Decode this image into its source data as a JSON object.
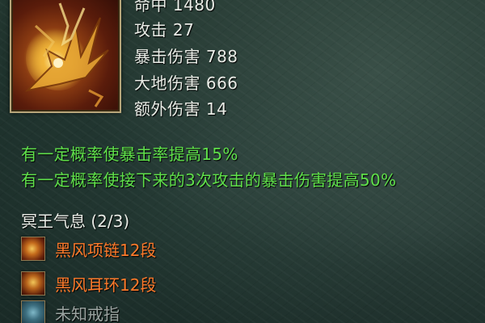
{
  "item": {
    "partial_top_line": "命中 1480",
    "stats": [
      {
        "label": "攻击",
        "value": "27",
        "text": "攻击 27"
      },
      {
        "label": "暴击伤害",
        "value": "788",
        "text": "暴击伤害 788"
      },
      {
        "label": "大地伤害",
        "value": "666",
        "text": "大地伤害 666"
      },
      {
        "label": "额外伤害",
        "value": "14",
        "text": "额外伤害 14"
      }
    ],
    "effects": [
      "有一定概率使暴击率提高15%",
      "有一定概率使接下来的3次攻击的暴击伤害提高50%"
    ],
    "icon": "golden-claw-weapon-icon"
  },
  "set": {
    "title": "冥王气息 (2/3)",
    "pieces": [
      {
        "name": "黑风项链12段",
        "status": "owned",
        "icon": "necklace-icon",
        "color": "#ff7a2a"
      },
      {
        "name": "黑风耳环12段",
        "status": "owned",
        "icon": "earring-icon",
        "color": "#ff7a2a"
      },
      {
        "name": "未知戒指",
        "status": "unknown",
        "icon": "unknown-ring-icon",
        "color": "#9aa3a0"
      }
    ]
  },
  "colors": {
    "stat_text": "#e9ece6",
    "effect_text": "#5fe04a",
    "owned_set_text": "#ff7a2a",
    "unknown_set_text": "#9aa3a0",
    "background": "#1d302b",
    "icon_border": "#b7a67a"
  }
}
